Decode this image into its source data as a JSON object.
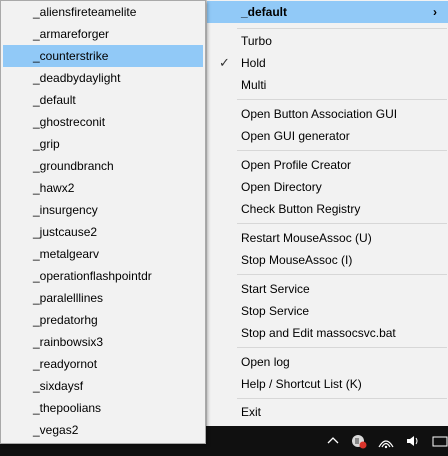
{
  "main_menu": {
    "profile_item": {
      "label": "_default"
    },
    "modes": [
      {
        "label": "Turbo",
        "checked": false
      },
      {
        "label": "Hold",
        "checked": true
      },
      {
        "label": "Multi",
        "checked": false
      }
    ],
    "gui_items": [
      "Open Button Association GUI",
      "Open GUI generator"
    ],
    "profile_tools": [
      "Open Profile Creator",
      "Open Directory",
      "Check Button Registry"
    ],
    "mouseassoc": [
      "Restart MouseAssoc (U)",
      "Stop MouseAssoc (I)"
    ],
    "service": [
      "Start Service",
      "Stop Service",
      "Stop and Edit massocsvc.bat"
    ],
    "help_items": [
      "Open log",
      "Help / Shortcut List (K)"
    ],
    "exit_label": "Exit"
  },
  "profiles_submenu": {
    "selected": "_counterstrike",
    "items": [
      "_aliensfireteamelite",
      "_armareforger",
      "_counterstrike",
      "_deadbydaylight",
      "_default",
      "_ghostreconit",
      "_grip",
      "_groundbranch",
      "_hawx2",
      "_insurgency",
      "_justcause2",
      "_metalgearv",
      "_operationflashpointdr",
      "_paralelllines",
      "_predatorhg",
      "_rainbowsix3",
      "_readyornot",
      "_sixdaysf",
      "_thepoolians",
      "_vegas2"
    ]
  },
  "icons": {
    "check": "checkmark-icon",
    "submenu_arrow": "chevron-right-icon",
    "tray": [
      "chevron-up-icon",
      "app-tray-icon",
      "wifi-icon",
      "volume-icon",
      "keyboard-icon"
    ]
  },
  "colors": {
    "highlight": "#91c9f7",
    "taskbar": "#101010",
    "menu_bg": "#f2f2f2"
  }
}
